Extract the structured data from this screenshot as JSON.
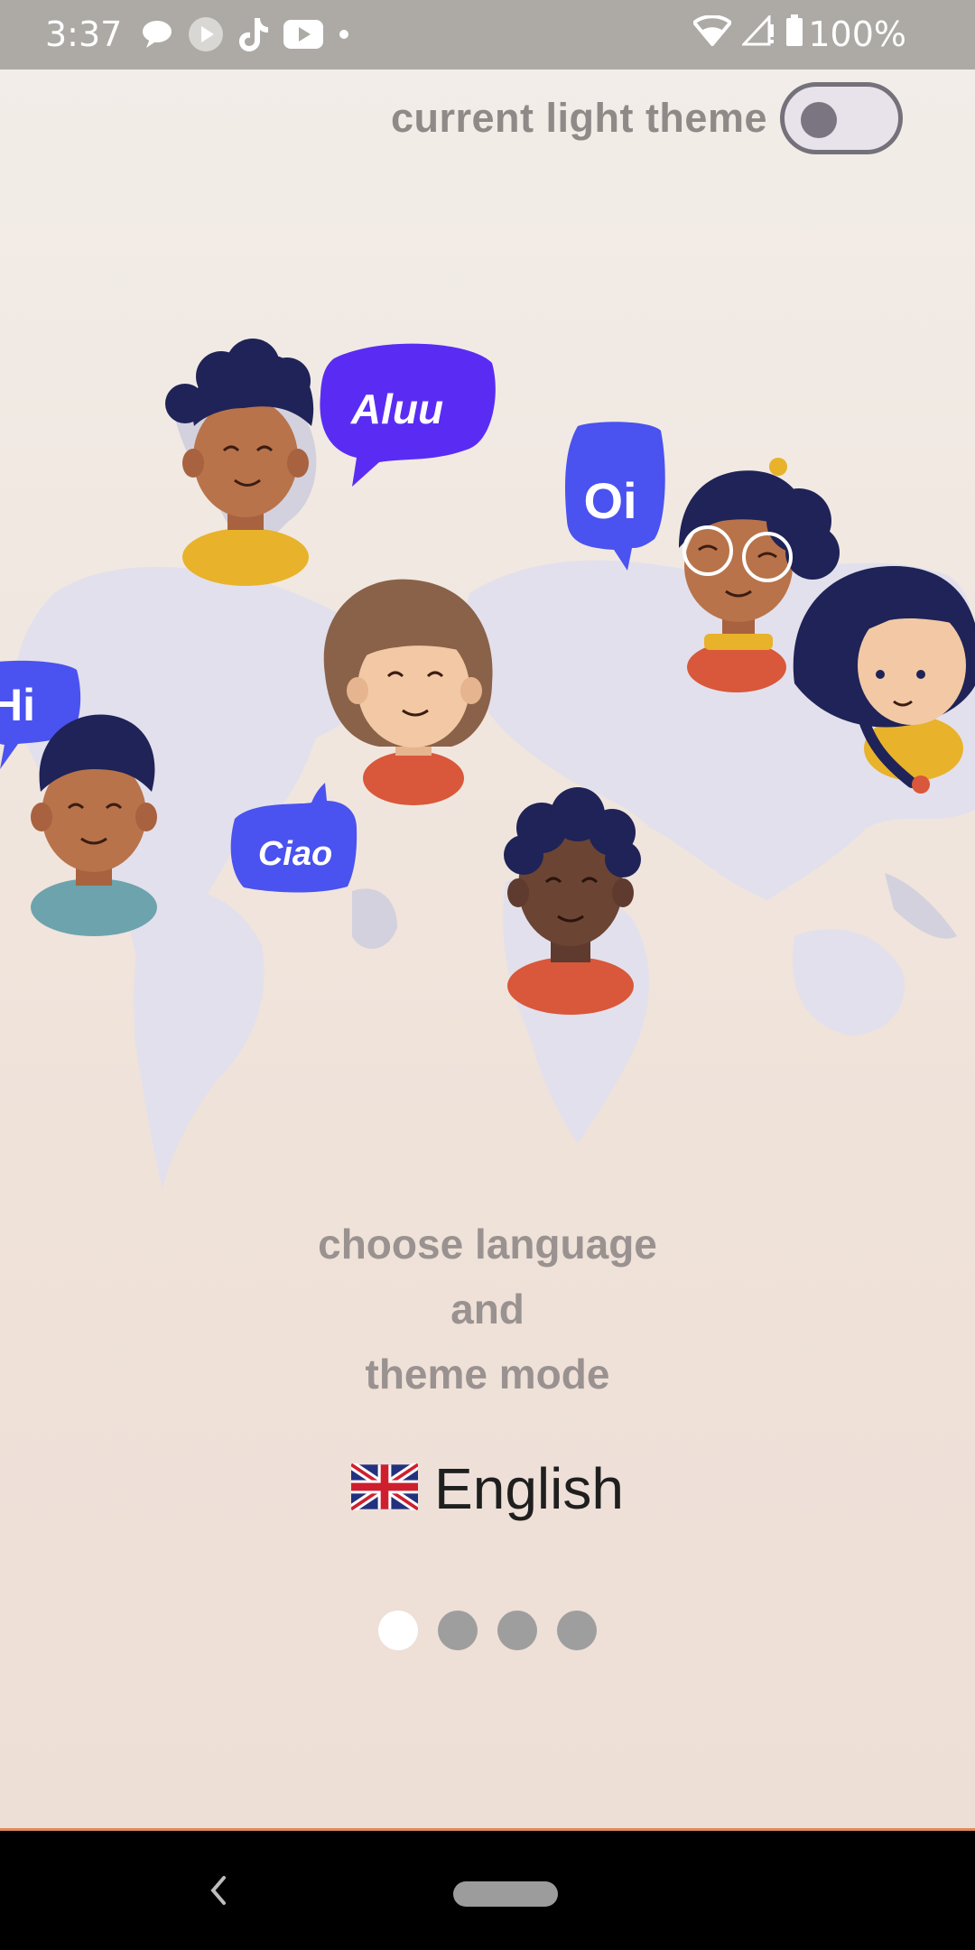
{
  "status_bar": {
    "time": "3:37",
    "battery": "100%",
    "icons_left": [
      "chat-bubble-icon",
      "play-icon",
      "tiktok-icon",
      "youtube-icon",
      "dot-icon"
    ],
    "icons_right": [
      "wifi-icon",
      "signal-icon",
      "battery-icon"
    ]
  },
  "theme_toggle": {
    "label": "current light theme",
    "state": "off"
  },
  "illustration": {
    "bubbles": [
      "Aluu",
      "Oi",
      "Hi",
      "Ciao"
    ]
  },
  "headline": {
    "line1": "choose language",
    "line2": "and",
    "line3": "theme mode"
  },
  "language": {
    "flag": "🇬🇧",
    "label": "English"
  },
  "pager": {
    "total": 4,
    "active_index": 0
  },
  "colors": {
    "bubble_blue": "#4a52f0",
    "bubble_violet": "#5a2cf3",
    "status_bar": "#adaaa6",
    "navy_hair": "#1f2357"
  }
}
